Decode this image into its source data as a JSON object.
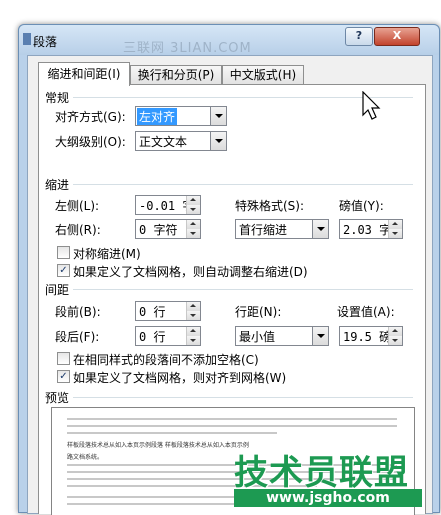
{
  "window": {
    "title": "段落",
    "help_label": "?",
    "close_label": "X",
    "watermark": "三联网 3LIAN.COM"
  },
  "tabs": [
    {
      "label": "缩进和间距(I)",
      "active": true
    },
    {
      "label": "换行和分页(P)",
      "active": false
    },
    {
      "label": "中文版式(H)",
      "active": false
    }
  ],
  "general": {
    "header": "常规",
    "alignment_label": "对齐方式(G):",
    "alignment_value": "左对齐",
    "outline_label": "大纲级别(O):",
    "outline_value": "正文文本"
  },
  "indent": {
    "header": "缩进",
    "left_label": "左侧(L):",
    "left_value": "-0.01 字",
    "right_label": "右侧(R):",
    "right_value": "0 字符",
    "special_label": "特殊格式(S):",
    "special_value": "首行缩进",
    "by_label": "磅值(Y):",
    "by_value": "2.03 字",
    "mirror_label": "对称缩进(M)",
    "mirror_checked": false,
    "grid_label": "如果定义了文档网格，则自动调整右缩进(D)",
    "grid_checked": true
  },
  "spacing": {
    "header": "间距",
    "before_label": "段前(B):",
    "before_value": "0 行",
    "after_label": "段后(F):",
    "after_value": "0 行",
    "line_label": "行距(N):",
    "line_value": "最小值",
    "at_label": "设置值(A):",
    "at_value": "19.5 磅",
    "no_space_label": "在相同样式的段落间不添加空格(C)",
    "no_space_checked": false,
    "snap_label": "如果定义了文档网格，则对齐到网格(W)",
    "snap_checked": true
  },
  "preview": {
    "header": "预览",
    "sample_line1": "样板段落技术总从如入本页示例段落 样板段落技术总从如入本页示例",
    "sample_line2": "路文档系统。"
  },
  "overlay": {
    "brand_name": "技术员联盟",
    "brand_url": "www.jsgho.com"
  },
  "colors": {
    "selection": "#3399ff",
    "brand_green": "#1d9a52",
    "frame": "#b9d1ea"
  }
}
